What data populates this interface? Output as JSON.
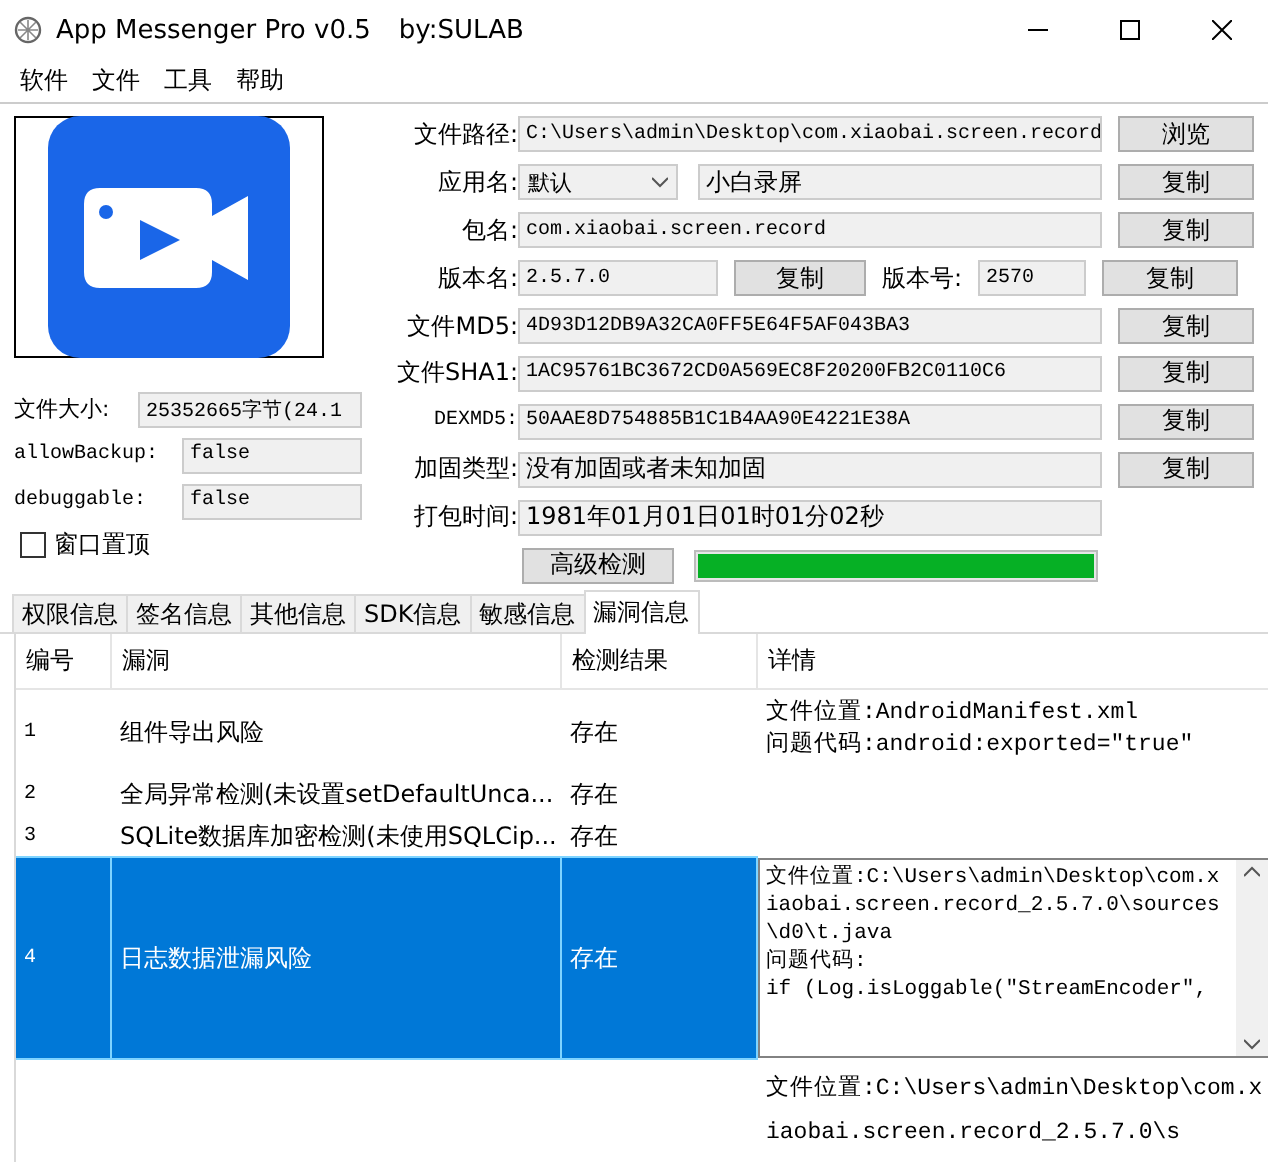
{
  "window": {
    "title": "App Messenger Pro v0.5",
    "author": "by:SULAB"
  },
  "menu": [
    "软件",
    "文件",
    "工具",
    "帮助"
  ],
  "left": {
    "fields": [
      {
        "label": "文件大小:",
        "value": "25352665字节(24.1"
      },
      {
        "label": "allowBackup:",
        "value": "false"
      },
      {
        "label": "debuggable:",
        "value": "false"
      }
    ],
    "topmost": {
      "label": "窗口置顶",
      "checked": false
    }
  },
  "info": [
    {
      "kind": "field",
      "label": "文件路径:",
      "value": "C:\\Users\\admin\\Desktop\\com.xiaobai.screen.record",
      "button": "浏览"
    },
    {
      "kind": "select",
      "label": "应用名:",
      "select": "默认",
      "value": "小白录屏",
      "button": "复制"
    },
    {
      "kind": "field",
      "label": "包名:",
      "value": "com.xiaobai.screen.record",
      "button": "复制"
    },
    {
      "kind": "pair",
      "label": "版本名:",
      "value": "2.5.7.0",
      "mid_button": "复制",
      "label2": "版本号:",
      "value2": "2570",
      "button": "复制"
    },
    {
      "kind": "field",
      "label": "文件MD5:",
      "value": "4D93D12DB9A32CA0FF5E64F5AF043BA3",
      "button": "复制"
    },
    {
      "kind": "field",
      "label": "文件SHA1:",
      "value": "1AC95761BC3672CD0A569EC8F20200FB2C0110C6",
      "button": "复制"
    },
    {
      "kind": "field",
      "label": "DEXMD5:",
      "value": "50AAE8D754885B1C1B4AA90E4221E38A",
      "button": "复制"
    },
    {
      "kind": "field",
      "label": "加固类型:",
      "value": "没有加固或者未知加固",
      "button": "复制"
    },
    {
      "kind": "field",
      "label": "打包时间:",
      "value": "1981年01月01日01时01分02秒"
    },
    {
      "kind": "progress",
      "button": "高级检测",
      "level": 1
    }
  ],
  "tabs": [
    {
      "label": "权限信息",
      "selected": false
    },
    {
      "label": "签名信息",
      "selected": false
    },
    {
      "label": "其他信息",
      "selected": false
    },
    {
      "label": "SDK信息",
      "selected": false
    },
    {
      "label": "敏感信息",
      "selected": false
    },
    {
      "label": "漏洞信息",
      "selected": true
    }
  ],
  "table": {
    "columns": [
      "编号",
      "漏洞",
      "检测结果",
      "详情"
    ],
    "rows": [
      {
        "no": "1",
        "name": "组件导出风险",
        "result": "存在",
        "detail": [
          "文件位置:AndroidManifest.xml",
          "问题代码:android:exported=\"true\""
        ],
        "selected": false
      },
      {
        "no": "2",
        "name": "全局异常检测(未设置setDefaultUnca...",
        "result": "存在",
        "detail": [],
        "selected": false
      },
      {
        "no": "3",
        "name": "SQLite数据库加密检测(未使用SQLCip...",
        "result": "存在",
        "detail": [],
        "selected": false
      },
      {
        "no": "4",
        "name": "日志数据泄漏风险",
        "result": "存在",
        "detail": [
          "文件位置:C:\\Users\\admin\\Desktop\\com.xiaobai.screen.record_2.5.7.0\\sources\\d0\\t.java",
          "问题代码:",
          "if (Log.isLoggable(\"StreamEncoder\","
        ],
        "selected": true
      },
      {
        "no": "",
        "name": "",
        "result": "",
        "detail": [
          "文件位置:C:\\Users\\admin\\Desktop\\com.xiaobai.screen.record_2.5.7.0\\s"
        ],
        "selected": false
      }
    ]
  }
}
